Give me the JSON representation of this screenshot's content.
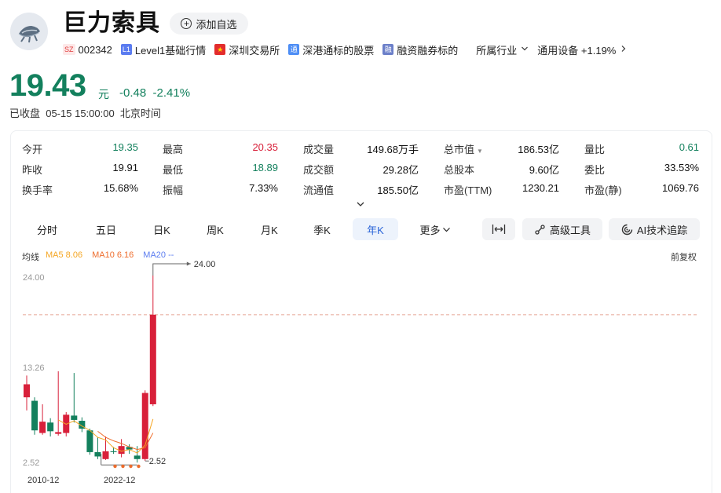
{
  "header": {
    "title": "巨力索具",
    "watch_label": "添加自选",
    "tags": [
      {
        "badge": "SZ",
        "text": "002342"
      },
      {
        "badge": "L1",
        "text": "Level1基础行情"
      },
      {
        "badge": "",
        "text": "深圳交易所"
      },
      {
        "badge": "通",
        "text": "深港通标的股票"
      },
      {
        "badge": "融",
        "text": "融资融券标的"
      },
      {
        "text": "所属行业"
      },
      {
        "text": "通用设备 +1.19%"
      }
    ]
  },
  "price": {
    "value": "19.43",
    "unit": "元",
    "change": "-0.48",
    "change_pct": "-2.41%",
    "status": "已收盘  05-15 15:00:00  北京时间"
  },
  "quote": {
    "col1": [
      {
        "label": "今开",
        "value": "19.35"
      },
      {
        "label": "昨收",
        "value": "19.91"
      },
      {
        "label": "换手率",
        "value": "15.68%"
      }
    ],
    "col2": [
      {
        "label": "最高",
        "value": "20.35"
      },
      {
        "label": "最低",
        "value": "18.89"
      },
      {
        "label": "振幅",
        "value": "7.33%"
      }
    ],
    "col3": [
      {
        "label": "成交量",
        "value": "149.68万手"
      },
      {
        "label": "成交额",
        "value": "29.28亿"
      },
      {
        "label": "流通值",
        "value": "185.50亿"
      }
    ],
    "col4": [
      {
        "label": "总市值",
        "value": "186.53亿"
      },
      {
        "label": "总股本",
        "value": "9.60亿"
      },
      {
        "label": "市盈(TTM)",
        "value": "1230.21"
      }
    ],
    "col5": [
      {
        "label": "量比",
        "value": "0.61"
      },
      {
        "label": "委比",
        "value": "33.53%"
      },
      {
        "label": "市盈(静)",
        "value": "1069.76"
      }
    ]
  },
  "tabs": [
    "分时",
    "五日",
    "日K",
    "周K",
    "月K",
    "季K",
    "年K",
    "更多"
  ],
  "tools": {
    "advanced": "高级工具",
    "ai": "AI技术追踪"
  },
  "ma": {
    "label": "均线",
    "ma5": "MA5 8.06",
    "ma10": "MA10 6.16",
    "ma20": "MA20 --"
  },
  "restore": "前复权",
  "colors": {
    "up": "#d8203a",
    "down": "#13805d",
    "ma5": "#f5a623",
    "ma10": "#ee6c2b",
    "ma20": "#5b7cf0",
    "active_tab": "#2a64d8"
  },
  "chart_data": {
    "type": "candlestick",
    "y_ticks": [
      "24.00",
      "13.26",
      "2.52"
    ],
    "x_ticks": [
      "2010-12",
      "2022-12"
    ],
    "max_label": "24.00",
    "min_label": "2.52",
    "ylim": [
      2.52,
      24.0
    ],
    "candles": [
      {
        "o": 10.0,
        "c": 11.5,
        "h": 12.5,
        "l": 8.5
      },
      {
        "o": 9.6,
        "c": 6.2,
        "h": 10.0,
        "l": 5.7
      },
      {
        "o": 5.9,
        "c": 7.2,
        "h": 9.2,
        "l": 5.7
      },
      {
        "o": 7.1,
        "c": 6.1,
        "h": 7.6,
        "l": 5.5
      },
      {
        "o": 5.8,
        "c": 6.0,
        "h": 13.0,
        "l": 5.6
      },
      {
        "o": 5.9,
        "c": 8.0,
        "h": 8.3,
        "l": 5.5
      },
      {
        "o": 7.9,
        "c": 7.4,
        "h": 12.8,
        "l": 7.1
      },
      {
        "o": 7.3,
        "c": 6.4,
        "h": 7.7,
        "l": 6.0
      },
      {
        "o": 6.2,
        "c": 3.7,
        "h": 6.4,
        "l": 3.4
      },
      {
        "o": 3.7,
        "c": 3.2,
        "h": 5.4,
        "l": 2.9
      },
      {
        "o": 2.9,
        "c": 3.8,
        "h": 5.5,
        "l": 2.8
      },
      {
        "o": 3.8,
        "c": 3.7,
        "h": 4.3,
        "l": 3.5
      },
      {
        "o": 3.5,
        "c": 4.4,
        "h": 5.2,
        "l": 3.1
      },
      {
        "o": 4.3,
        "c": 4.0,
        "h": 4.6,
        "l": 3.5
      },
      {
        "o": 3.3,
        "c": 2.9,
        "h": 4.4,
        "l": 2.5
      },
      {
        "o": 2.9,
        "c": 10.5,
        "h": 10.8,
        "l": 2.7
      },
      {
        "o": 9.2,
        "c": 19.5,
        "h": 24.0,
        "l": 9.0
      }
    ],
    "ma5": [
      null,
      null,
      null,
      null,
      7.4,
      6.9,
      7.3,
      6.7,
      6.2,
      5.4,
      5.1,
      4.2,
      3.8,
      4.0,
      3.6,
      4.5,
      7.5
    ],
    "ma10": [
      null,
      null,
      null,
      null,
      null,
      null,
      null,
      null,
      null,
      6.1,
      5.4,
      5.0,
      4.7,
      4.3,
      4.0,
      4.2,
      5.9
    ],
    "dashed_level": 19.5
  }
}
